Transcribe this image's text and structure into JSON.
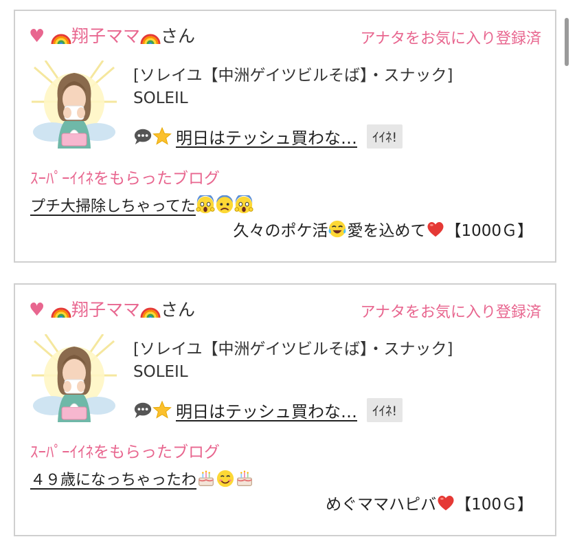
{
  "posts": [
    {
      "user": {
        "name": "翔子ママ",
        "suffix": "さん"
      },
      "favorite_status": "アナタをお気に入り登録済",
      "shop": {
        "name": "[ソレイユ【中洲ゲイツビルそば】・スナック]",
        "sub": "SOLEIL"
      },
      "status": {
        "text": "明日はテッシュ買わな…",
        "iine_label": "ｲｲﾈ!"
      },
      "blog": {
        "heading": "ｽｰﾊﾟｰｲｲﾈをもらったブログ",
        "title": "プチ大掃除しちゃってた",
        "title_emoji": [
          "scream-face",
          "fearful-face",
          "scream-face"
        ]
      },
      "gift": {
        "text": "久々のポケ活",
        "text_after": "愛を込めて",
        "amount": "【1000Ｇ】",
        "emoji_mid": "tears-of-joy-face",
        "emoji_end": "red-heart"
      }
    },
    {
      "user": {
        "name": "翔子ママ",
        "suffix": "さん"
      },
      "favorite_status": "アナタをお気に入り登録済",
      "shop": {
        "name": "[ソレイユ【中洲ゲイツビルそば】・スナック]",
        "sub": "SOLEIL"
      },
      "status": {
        "text": "明日はテッシュ買わな…",
        "iine_label": "ｲｲﾈ!"
      },
      "blog": {
        "heading": "ｽｰﾊﾟｰｲｲﾈをもらったブログ",
        "title": "４９歳になっちゃったわ",
        "title_emoji": [
          "birthday-cake",
          "smiling-face",
          "birthday-cake"
        ]
      },
      "gift": {
        "text": "めぐママハピバ",
        "amount": "【100Ｇ】",
        "emoji_end": "red-heart"
      }
    }
  ],
  "colors": {
    "accent": "#e8668f",
    "border": "#cfcfcf",
    "button_bg": "#e6e6e6"
  }
}
